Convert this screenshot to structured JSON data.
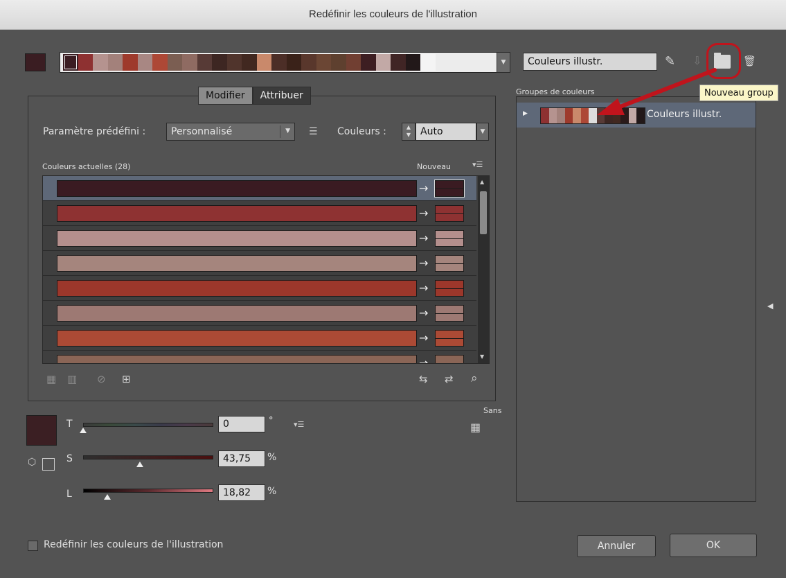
{
  "window": {
    "title": "Redéfinir les couleurs de l'illustration"
  },
  "harmony": {
    "swatches": [
      "#3a1d22",
      "#8e3131",
      "#b5938f",
      "#a3817b",
      "#9e3a2c",
      "#a88783",
      "#ad4836",
      "#7b5e52",
      "#8f6b62",
      "#573a36",
      "#3d2622",
      "#50342c",
      "#412820",
      "#c9896b",
      "#4c2e27",
      "#3a2219",
      "#59372c",
      "#6b4634",
      "#5e402f",
      "#713f32",
      "#3d1e22",
      "#c2a9a6",
      "#402525",
      "#221819",
      "#f4f4f4"
    ]
  },
  "group_name_field": {
    "value": "Couleurs illustr."
  },
  "tabs": {
    "modifier": "Modifier",
    "attribuer": "Attribuer"
  },
  "preset": {
    "label": "Paramètre prédéfini :",
    "value": "Personnalisé"
  },
  "couleurs": {
    "label": "Couleurs :",
    "value": "Auto"
  },
  "list": {
    "header_left": "Couleurs actuelles (28)",
    "header_right": "Nouveau",
    "rows": [
      {
        "color": "#3a1b22"
      },
      {
        "color": "#8e3232"
      },
      {
        "color": "#b48f8d"
      },
      {
        "color": "#a5857d"
      },
      {
        "color": "#9c372b"
      },
      {
        "color": "#9d7973"
      },
      {
        "color": "#ac4a35"
      },
      {
        "color": "#8a6556"
      }
    ],
    "arrow": "→"
  },
  "sans_label": "Sans",
  "hsl": {
    "current_color": "#3b1f23",
    "t": {
      "label": "T",
      "value": "0",
      "unit": "°",
      "level": 0
    },
    "s": {
      "label": "S",
      "value": "43,75",
      "unit": "%",
      "level": 43.75
    },
    "l": {
      "label": "L",
      "value": "18,82",
      "unit": "%",
      "level": 18.82
    }
  },
  "groups": {
    "title": "Groupes de couleurs",
    "items": [
      {
        "name": "Couleurs illustr."
      }
    ],
    "thumb": [
      "#8e3131",
      "#b5938f",
      "#a3817b",
      "#9e3a2c",
      "#c9896b",
      "#ad4836",
      "#ddd",
      "#573a36",
      "#3d2622",
      "#412820",
      "#2a1a1a",
      "#c2a9a6",
      "#221819"
    ]
  },
  "tooltip": {
    "text": "Nouveau group"
  },
  "footer": {
    "checkbox_label": "Redéfinir les couleurs de l'illustration",
    "cancel": "Annuler",
    "ok": "OK"
  },
  "annotation_color": "#c0141c"
}
